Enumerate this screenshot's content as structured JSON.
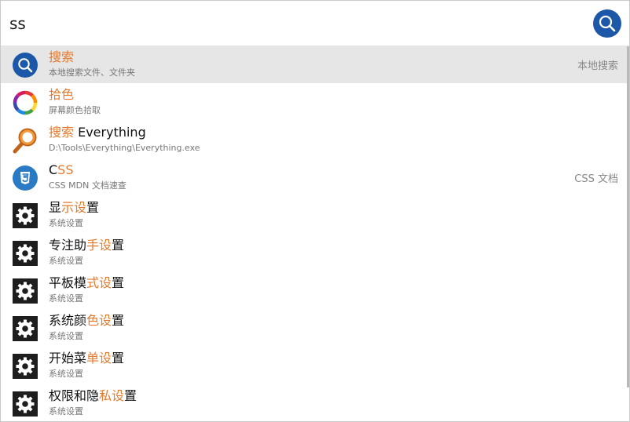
{
  "search": {
    "value": "ss"
  },
  "results": [
    {
      "icon": "magnifier-circle-icon",
      "title_segments": [
        {
          "text": "搜索",
          "hl": true
        }
      ],
      "subtitle": "本地搜索文件、文件夹",
      "right_label": "本地搜索",
      "selected": true
    },
    {
      "icon": "color-ring-icon",
      "title_segments": [
        {
          "text": "拾色",
          "hl": true
        }
      ],
      "subtitle": "屏幕颜色拾取",
      "right_label": "",
      "selected": false
    },
    {
      "icon": "everything-magnifier-icon",
      "title_segments": [
        {
          "text": "搜索",
          "hl": true
        },
        {
          "text": " Everything",
          "hl": false
        }
      ],
      "subtitle": "D:\\Tools\\Everything\\Everything.exe",
      "right_label": "",
      "selected": false
    },
    {
      "icon": "css3-icon",
      "title_segments": [
        {
          "text": "C",
          "hl": false
        },
        {
          "text": "SS",
          "hl": true
        }
      ],
      "subtitle": "CSS MDN 文档速查",
      "right_label": "CSS 文档",
      "selected": false
    },
    {
      "icon": "gear-icon",
      "title_segments": [
        {
          "text": "显",
          "hl": false
        },
        {
          "text": "示设",
          "hl": true
        },
        {
          "text": "置",
          "hl": false
        }
      ],
      "subtitle": "系统设置",
      "right_label": "",
      "selected": false
    },
    {
      "icon": "gear-icon",
      "title_segments": [
        {
          "text": "专注助",
          "hl": false
        },
        {
          "text": "手设",
          "hl": true
        },
        {
          "text": "置",
          "hl": false
        }
      ],
      "subtitle": "系统设置",
      "right_label": "",
      "selected": false
    },
    {
      "icon": "gear-icon",
      "title_segments": [
        {
          "text": "平板模",
          "hl": false
        },
        {
          "text": "式设",
          "hl": true
        },
        {
          "text": "置",
          "hl": false
        }
      ],
      "subtitle": "系统设置",
      "right_label": "",
      "selected": false
    },
    {
      "icon": "gear-icon",
      "title_segments": [
        {
          "text": "系统颜",
          "hl": false
        },
        {
          "text": "色设",
          "hl": true
        },
        {
          "text": "置",
          "hl": false
        }
      ],
      "subtitle": "系统设置",
      "right_label": "",
      "selected": false
    },
    {
      "icon": "gear-icon",
      "title_segments": [
        {
          "text": "开始菜",
          "hl": false
        },
        {
          "text": "单设",
          "hl": true
        },
        {
          "text": "置",
          "hl": false
        }
      ],
      "subtitle": "系统设置",
      "right_label": "",
      "selected": false
    },
    {
      "icon": "gear-icon",
      "title_segments": [
        {
          "text": "权限和隐",
          "hl": false
        },
        {
          "text": "私设",
          "hl": true
        },
        {
          "text": "置",
          "hl": false
        }
      ],
      "subtitle": "系统设置",
      "right_label": "",
      "selected": false
    }
  ],
  "colors": {
    "accent_blue": "#1d57a8",
    "highlight_orange": "#e8792c",
    "selected_row": "#e6e6e6",
    "css_blue": "#2a7bc4",
    "gear_bg": "#1e1e1e"
  }
}
